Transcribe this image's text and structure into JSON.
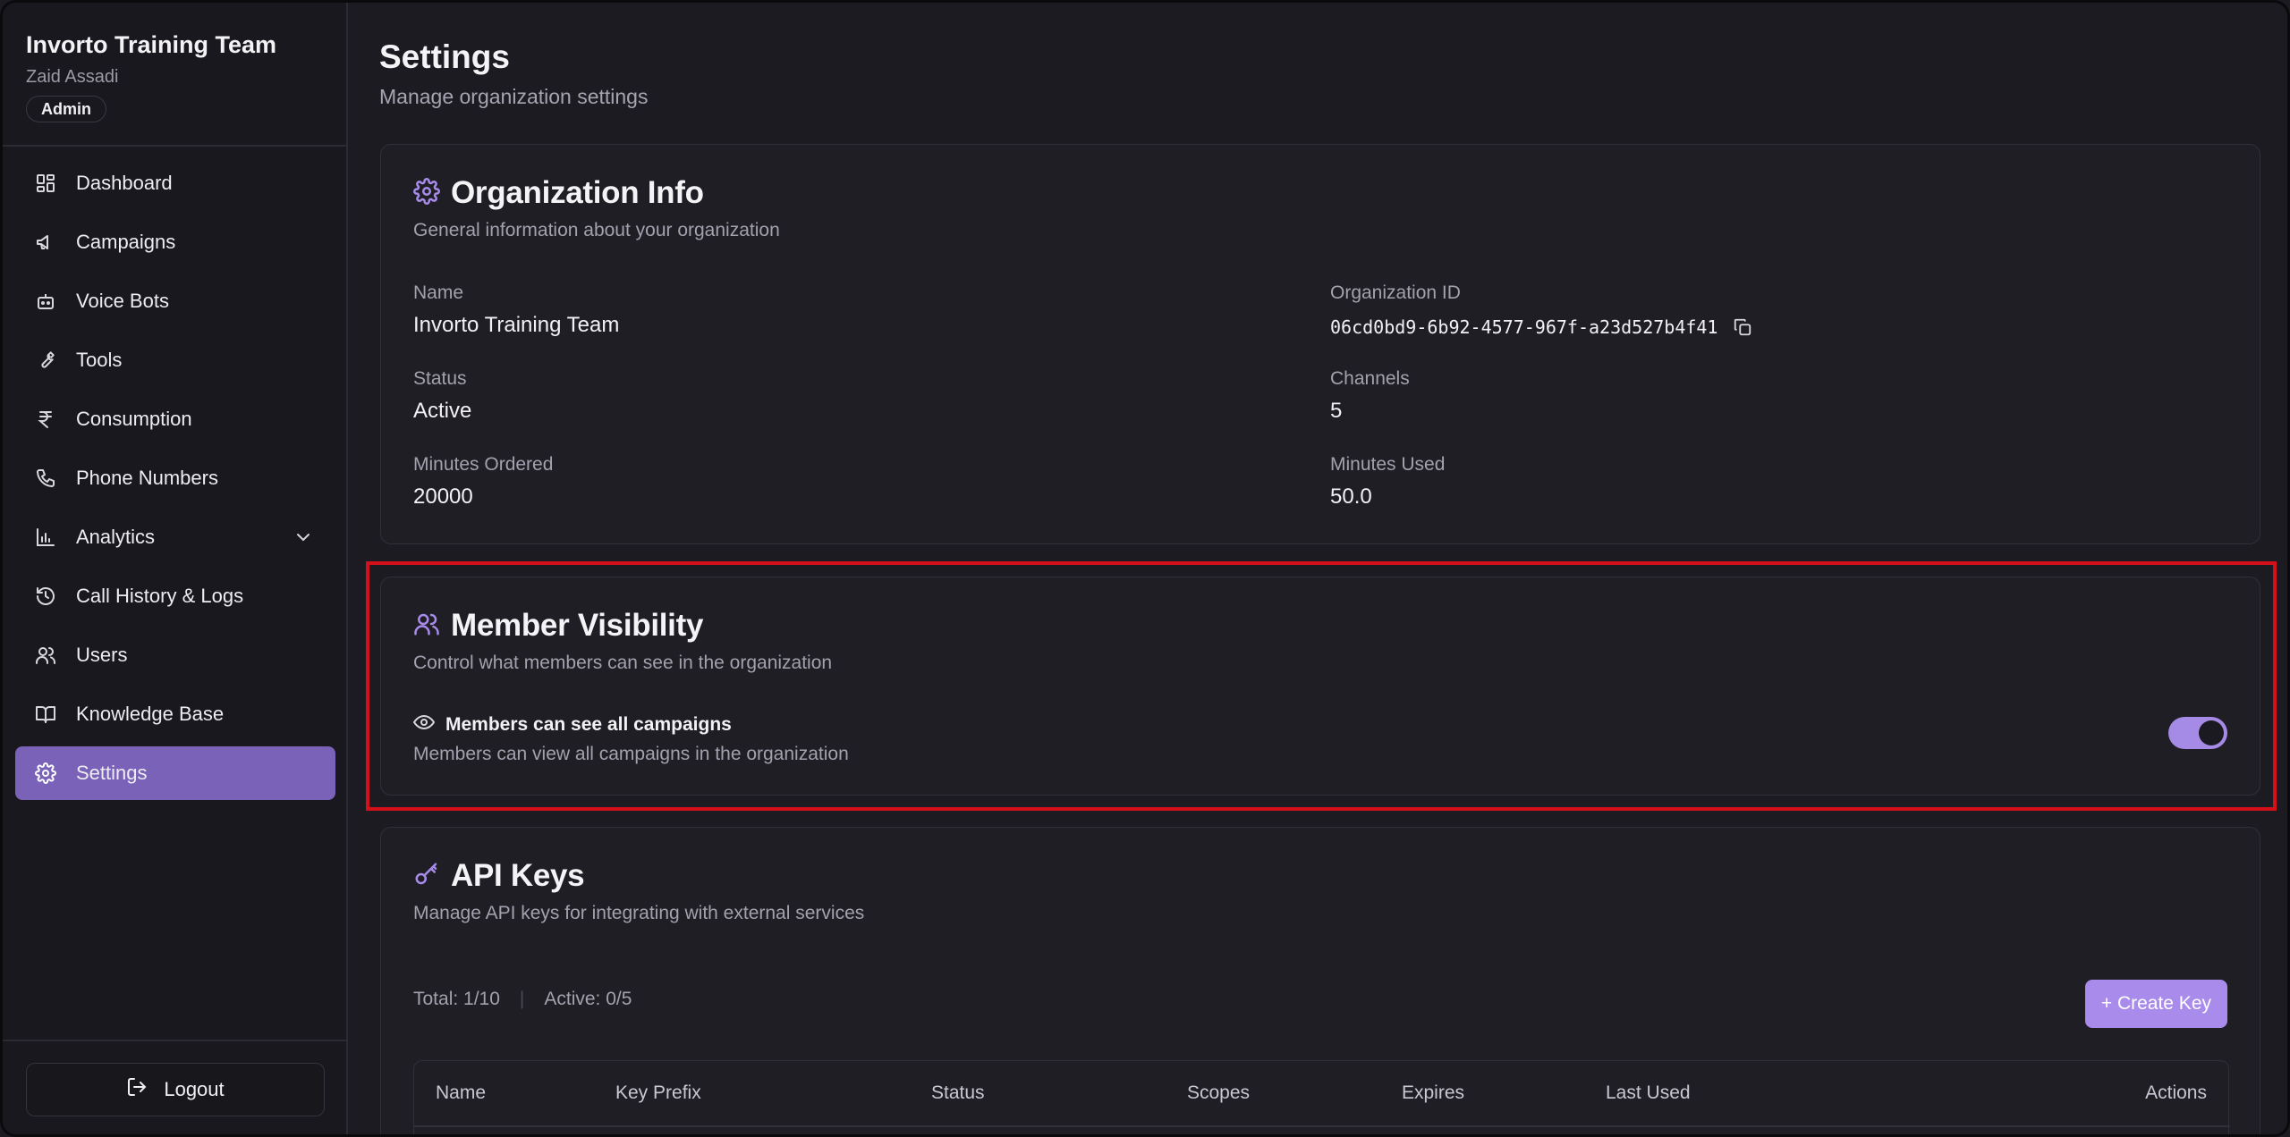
{
  "org_header": {
    "org_name": "Invorto Training Team",
    "user_name": "Zaid Assadi",
    "role_badge": "Admin"
  },
  "sidebar": {
    "items": [
      {
        "label": "Dashboard",
        "icon": "dashboard-icon"
      },
      {
        "label": "Campaigns",
        "icon": "megaphone-icon"
      },
      {
        "label": "Voice Bots",
        "icon": "bot-icon"
      },
      {
        "label": "Tools",
        "icon": "wrench-icon"
      },
      {
        "label": "Consumption",
        "icon": "rupee-icon"
      },
      {
        "label": "Phone Numbers",
        "icon": "phone-icon"
      },
      {
        "label": "Analytics",
        "icon": "bar-chart-icon"
      },
      {
        "label": "Call History & Logs",
        "icon": "history-icon"
      },
      {
        "label": "Users",
        "icon": "users-icon"
      },
      {
        "label": "Knowledge Base",
        "icon": "book-icon"
      },
      {
        "label": "Settings",
        "icon": "gear-icon"
      }
    ],
    "active_item": "Settings",
    "logout_label": "Logout"
  },
  "page": {
    "title": "Settings",
    "subtitle": "Manage organization settings"
  },
  "org_info": {
    "title": "Organization Info",
    "description": "General information about your organization",
    "fields": {
      "name_label": "Name",
      "name_value": "Invorto Training Team",
      "org_id_label": "Organization ID",
      "org_id_value": "06cd0bd9-6b92-4577-967f-a23d527b4f41",
      "status_label": "Status",
      "status_value": "Active",
      "channels_label": "Channels",
      "channels_value": "5",
      "minutes_ordered_label": "Minutes Ordered",
      "minutes_ordered_value": "20000",
      "minutes_used_label": "Minutes Used",
      "minutes_used_value": "50.0"
    }
  },
  "member_visibility": {
    "title": "Member Visibility",
    "description": "Control what members can see in the organization",
    "setting_title": "Members can see all campaigns",
    "setting_description": "Members can view all campaigns in the organization",
    "enabled": true
  },
  "api_keys": {
    "title": "API Keys",
    "description": "Manage API keys for integrating with external services",
    "total": "Total: 1/10",
    "active": "Active: 0/5",
    "create_button": "+ Create Key",
    "columns": [
      "Name",
      "Key Prefix",
      "Status",
      "Scopes",
      "Expires",
      "Last Used",
      "Actions"
    ]
  },
  "colors": {
    "accent": "#a88bea",
    "active_nav": "#7a62b8",
    "highlight": "#d4111a",
    "background": "#1c1b22"
  }
}
